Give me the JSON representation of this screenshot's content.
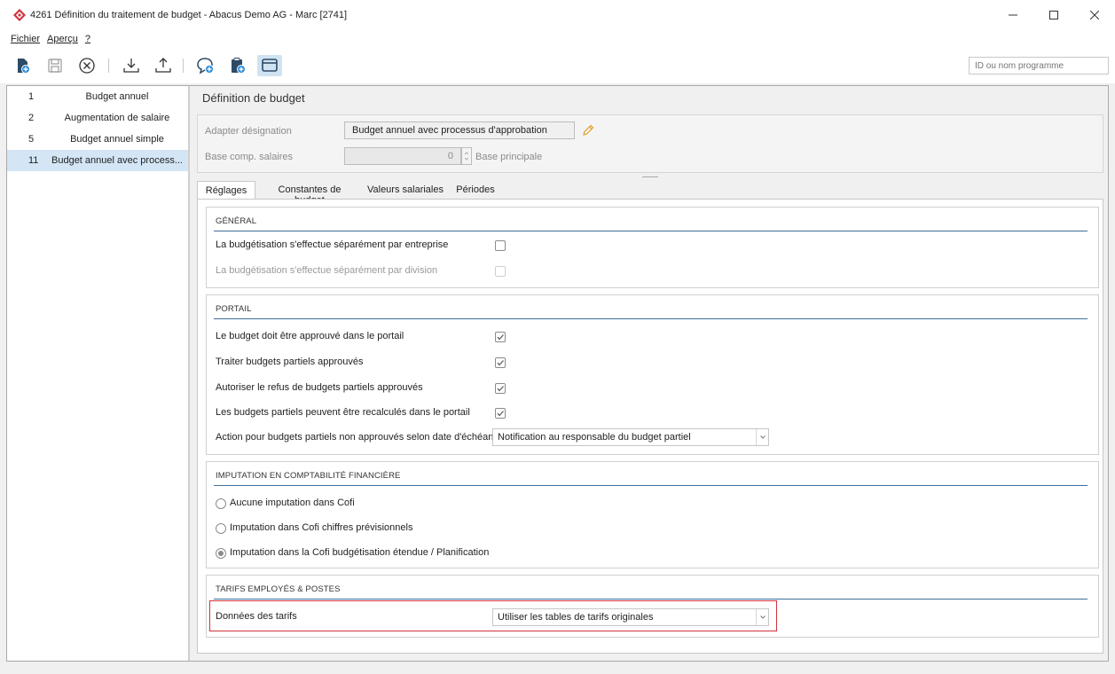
{
  "window": {
    "title": "4261 Définition du traitement de budget - Abacus Demo AG - Marc [2741]",
    "minimize_icon": "minimize-icon",
    "maximize_icon": "maximize-icon",
    "close_icon": "close-icon"
  },
  "menu": {
    "items": [
      "Fichier",
      "Aperçu",
      "?"
    ]
  },
  "toolbar": {
    "buttons": [
      "new-document-icon",
      "save-icon",
      "cancel-icon",
      "download-icon",
      "upload-icon",
      "comment-add-icon",
      "clipboard-add-icon",
      "window-icon"
    ],
    "program_search_placeholder": "ID ou nom programme"
  },
  "sidebar": {
    "items": [
      {
        "num": "1",
        "label": "Budget annuel"
      },
      {
        "num": "2",
        "label": "Augmentation de salaire"
      },
      {
        "num": "5",
        "label": "Budget annuel simple"
      },
      {
        "num": "11",
        "label": "Budget annuel avec process..."
      }
    ],
    "selected_index": 3
  },
  "header": {
    "title": "Définition de budget",
    "designation_label": "Adapter désignation",
    "designation_value": "Budget annuel avec processus d'approbation",
    "salary_base_label": "Base comp. salaires",
    "salary_base_value": "0",
    "salary_base_suffix": "Base principale"
  },
  "tabs": [
    {
      "label": "Réglages",
      "active": true
    },
    {
      "label": "Constantes de budget",
      "active": false
    },
    {
      "label": "Valeurs salariales",
      "active": false
    },
    {
      "label": "Périodes",
      "active": false
    }
  ],
  "general": {
    "title": "GÉNÉRAL",
    "by_company_label": "La budgétisation s'effectue séparément par entreprise",
    "by_company_checked": false,
    "by_division_label": "La budgétisation s'effectue séparément par division",
    "by_division_checked": false
  },
  "portal": {
    "title": "PORTAIL",
    "approve_label": "Le budget doit être approuvé dans le portail",
    "approve_checked": true,
    "process_label": "Traiter budgets partiels approuvés",
    "process_checked": true,
    "refuse_label": "Autoriser le refus de budgets partiels approuvés",
    "refuse_checked": true,
    "recalc_label": "Les budgets partiels peuvent être recalculés dans le portail",
    "recalc_checked": true,
    "action_label": "Action pour budgets partiels non approuvés selon date d'échéance",
    "action_value": "Notification au responsable du budget partiel"
  },
  "imputation": {
    "title": "IMPUTATION EN COMPTABILITÉ FINANCIÈRE",
    "options": [
      "Aucune imputation dans Cofi",
      "Imputation dans Cofi chiffres prévisionnels",
      "Imputation dans la Cofi budgétisation étendue / Planification"
    ],
    "selected_index": 2
  },
  "tariffs": {
    "title": "TARIFS EMPLOYÉS & POSTES",
    "data_label": "Données des tarifs",
    "data_value": "Utiliser les tables de tarifs originales"
  },
  "colors": {
    "accent_line": "#3f6f9c",
    "selection": "#d4e5f5",
    "highlight": "#d0323c",
    "logo": "#d0323c"
  }
}
